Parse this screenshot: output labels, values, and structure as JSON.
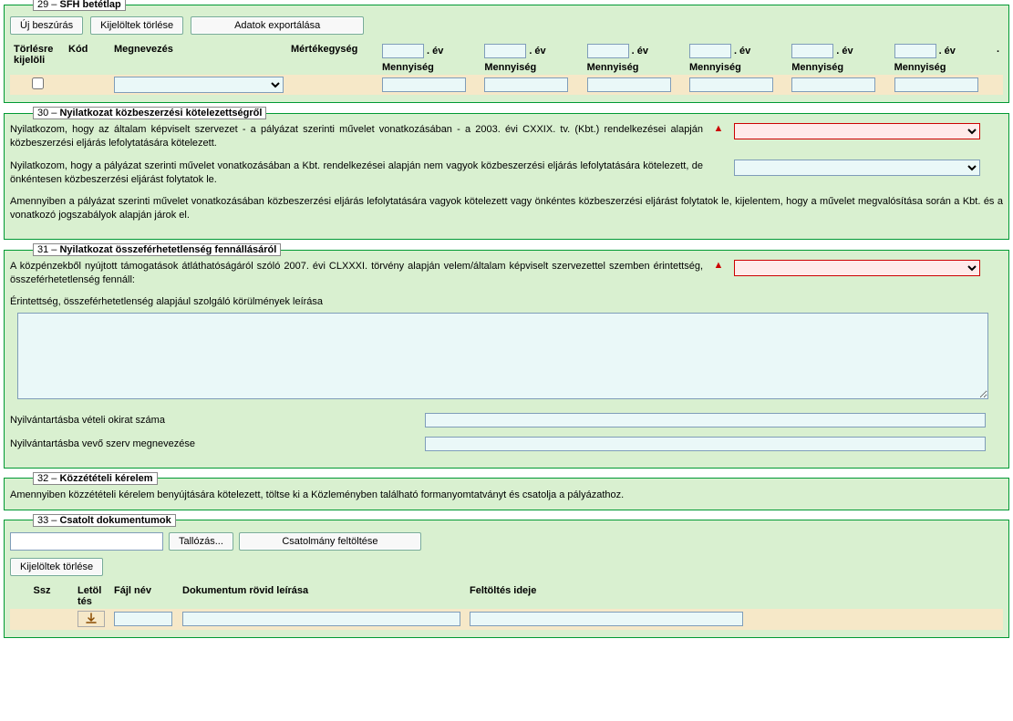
{
  "sections": {
    "s29": {
      "num": "29",
      "title": "SFH betétlap"
    },
    "s30": {
      "num": "30",
      "title": "Nyilatkozat közbeszerzési kötelezettségről"
    },
    "s31": {
      "num": "31",
      "title": "Nyilatkozat összeférhetetlenség fennállásáról"
    },
    "s32": {
      "num": "32",
      "title": "Közzétételi kérelem"
    },
    "s33": {
      "num": "33",
      "title": "Csatolt dokumentumok"
    }
  },
  "buttons": {
    "uj_beszuras": "Új beszúrás",
    "kijeloltek_torlese": "Kijelöltek törlése",
    "adatok_exportalasa": "Adatok exportálása",
    "tallozas": "Tallózás...",
    "csatolmany_feltoltese": "Csatolmány feltöltése"
  },
  "sfh_headers": {
    "torlesre": "Törlésre kijelöli",
    "kod": "Kód",
    "megnevezes": "Megnevezés",
    "mertekegyseg": "Mértékegység",
    "ev_suffix": ". év",
    "mennyiseg": "Mennyiség"
  },
  "s30": {
    "p1": "Nyilatkozom, hogy az általam képviselt szervezet - a pályázat szerinti művelet vonatkozásában - a 2003. évi CXXIX. tv. (Kbt.) rendelkezései alapján közbeszerzési eljárás lefolytatására kötelezett.",
    "p2": "Nyilatkozom, hogy a pályázat szerinti művelet vonatkozásában a Kbt. rendelkezései alapján nem vagyok közbeszerzési eljárás lefolytatására kötelezett, de önkéntesen közbeszerzési eljárást folytatok le.",
    "p3": "Amennyiben a pályázat szerinti művelet vonatkozásában közbeszerzési eljárás lefolytatására vagyok kötelezett vagy önkéntes közbeszerzési eljárást folytatok le, kijelentem, hogy a művelet megvalósítása során a Kbt. és a vonatkozó jogszabályok alapján járok el."
  },
  "s31": {
    "p1": "A közpénzekből nyújtott támogatások átláthatóságáról szóló 2007. évi CLXXXI. törvény alapján velem/általam képviselt szervezettel szemben érintettség, összeférhetetlenség fennáll:",
    "label_leiras": "Érintettség, összeférhetetlenség alapjául szolgáló körülmények leírása",
    "label_szam": "Nyilvántartásba vételi okirat száma",
    "label_szerv": "Nyilvántartásba vevő szerv megnevezése"
  },
  "s32": {
    "p1": "Amennyiben közzétételi kérelem benyújtására kötelezett, töltse ki a Közleményben található formanyomtatványt és csatolja a pályázathoz."
  },
  "s33_headers": {
    "ssz": "Ssz",
    "letoltes": "Letöl tés",
    "fajlnev": "Fájl név",
    "leiras": "Dokumentum rövid leírása",
    "feltoltes_ideje": "Feltöltés ideje"
  },
  "punct": {
    "dot": "."
  }
}
